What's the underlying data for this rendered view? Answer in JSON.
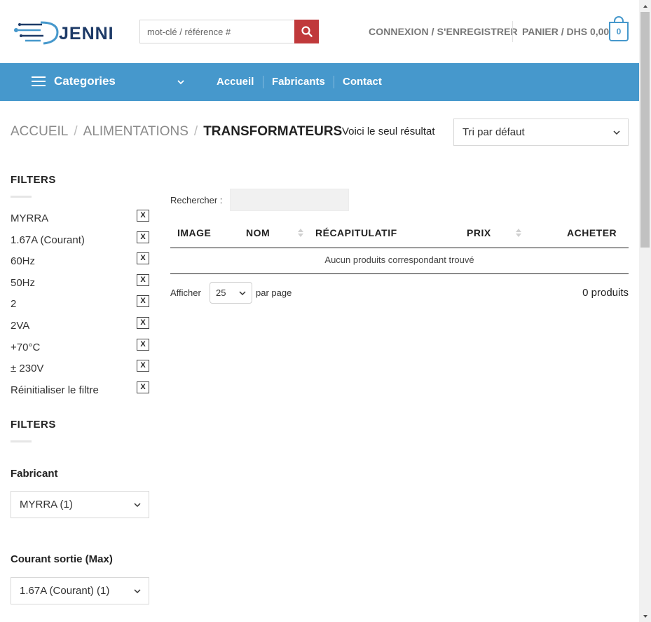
{
  "header": {
    "logo_text": "JENNI",
    "search_placeholder": "mot-clé / référence #",
    "login_label": "CONNEXION / S'ENREGISTRER",
    "cart_label": "PANIER / DHS 0,00",
    "cart_count": "0"
  },
  "nav": {
    "categories_label": "Categories",
    "links": [
      "Accueil",
      "Fabricants",
      "Contact"
    ]
  },
  "breadcrumb": {
    "items": [
      "ACCUEIL",
      "ALIMENTATIONS"
    ],
    "current": "TRANSFORMATEURS",
    "separator": "/"
  },
  "result_count": "Voici le seul résultat",
  "sort": {
    "selected": "Tri par défaut"
  },
  "sidebar": {
    "active_filters_title": "FILTERS",
    "active_filters": [
      "MYRRA",
      "1.67A (Courant)",
      "60Hz",
      "50Hz",
      "2",
      "2VA",
      "+70°C",
      "± 230V",
      "Réinitialiser le filtre"
    ],
    "remove_symbol": "X",
    "filters_title": "FILTERS",
    "fields": [
      {
        "label": "Fabricant",
        "selected": "MYRRA (1)"
      },
      {
        "label": "Courant sortie (Max)",
        "selected": "1.67A (Courant) (1)"
      }
    ]
  },
  "table": {
    "search_label": "Rechercher :",
    "columns": [
      "IMAGE",
      "NOM",
      "RÉCAPITULATIF",
      "PRIX",
      "ACHETER"
    ],
    "empty_message": "Aucun produits correspondant trouvé",
    "show_label": "Afficher",
    "per_page_value": "25",
    "per_page_label": "par page",
    "product_count": "0 produits"
  },
  "colors": {
    "brand_blue": "#4698cc",
    "search_button_red": "#c0393b",
    "logo_navy": "#1d3a67"
  }
}
